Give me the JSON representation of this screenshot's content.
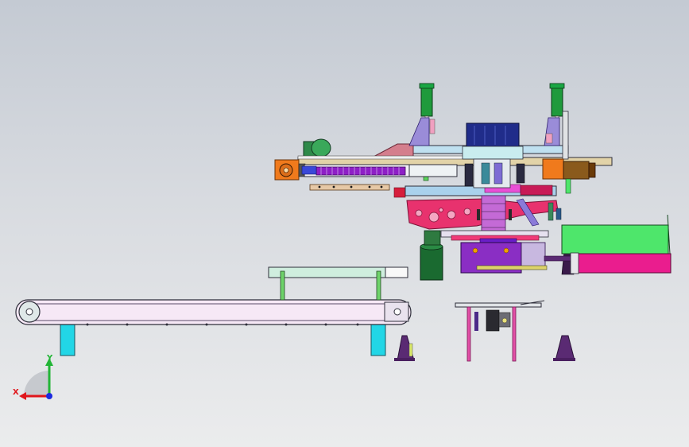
{
  "viewport": {
    "background_top": "#c4cad3",
    "background_bottom": "#ebeced"
  },
  "model": {
    "components": [
      "belt-conveyor",
      "infeed-guide-rail",
      "gantry-beam",
      "linear-module",
      "vertical-cylinder",
      "gripper-head",
      "rotary-table",
      "outfeed-platform",
      "support-stand",
      "control-cabinet"
    ],
    "colors": {
      "conveyor_belt": "#f6e8f6",
      "conveyor_legs": "#22d6e6",
      "guide_rail": "#cfeede",
      "gantry_beam": "#a9d1ec",
      "drag_chain": "#8e1fc6",
      "cylinder": "#1f9a3c",
      "motor_orange": "#f07a1c",
      "plate_red": "#e8326e",
      "cabinet_green": "#4ee66b",
      "cabinet_magenta": "#ea1d8e",
      "stand_purple": "#5a2a73",
      "stand_pink": "#e24fa6",
      "base_purple": "#8a2ec4",
      "navy_block": "#202c8a"
    }
  },
  "triad": {
    "x_label": "X",
    "y_label": "Y",
    "x_color": "#e0161c",
    "y_color": "#22b536",
    "z_color": "#1c2ae0"
  }
}
